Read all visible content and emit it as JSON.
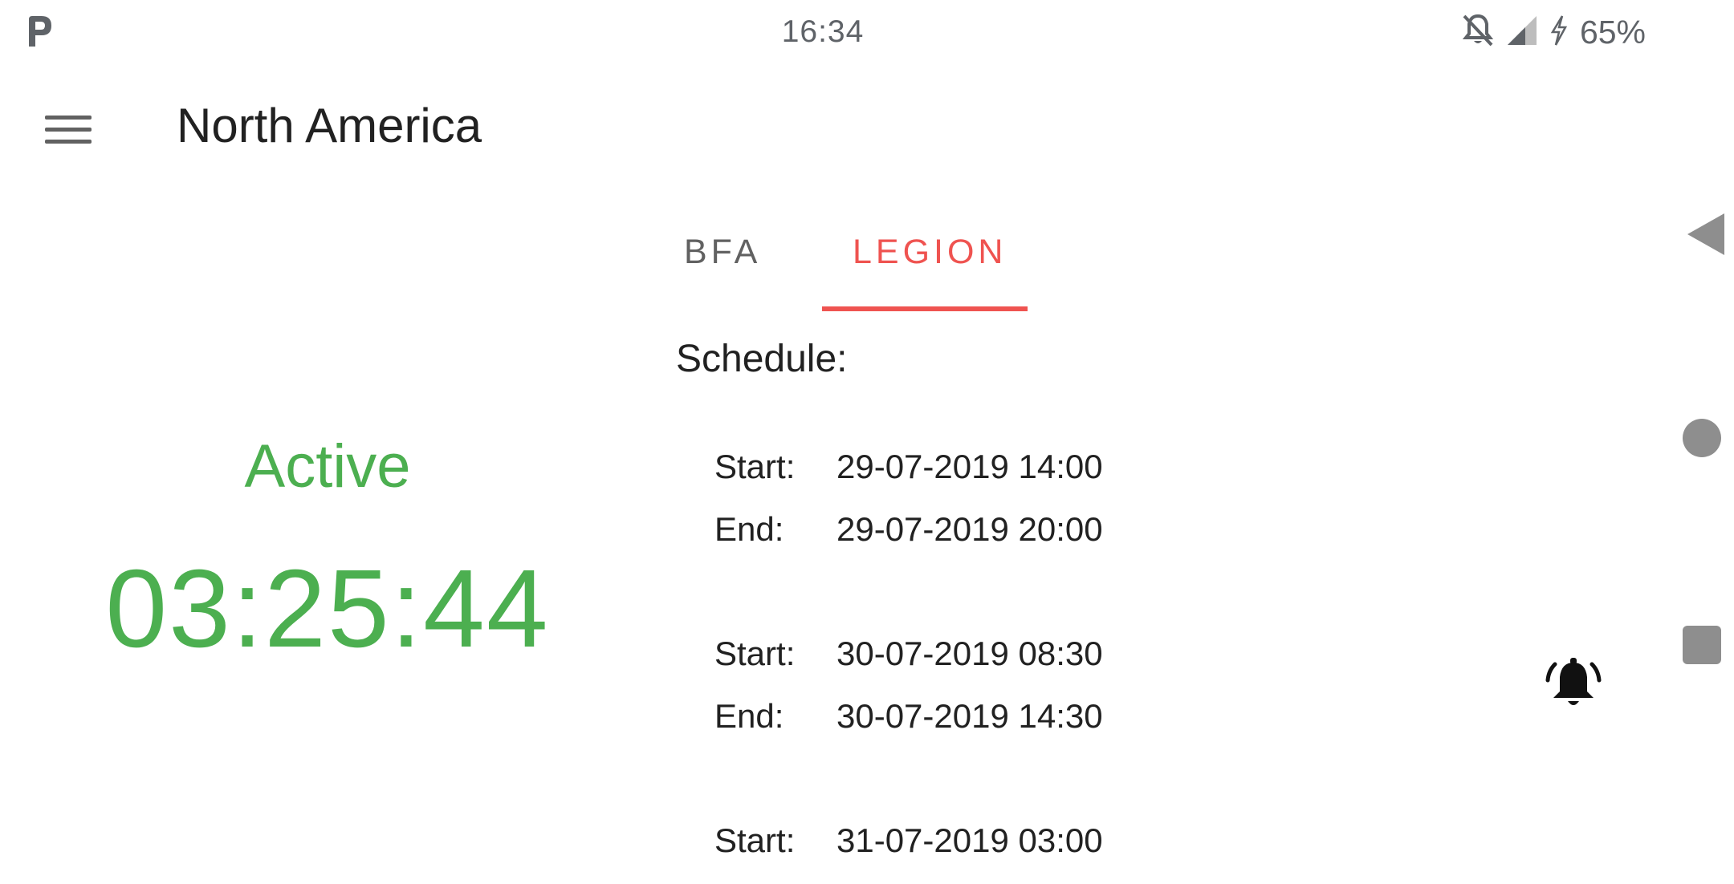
{
  "status_bar": {
    "time": "16:34",
    "battery_percent": "65%",
    "icons": [
      "parking-p-icon",
      "notifications-off-icon",
      "signal-icon",
      "charging-bolt-icon"
    ]
  },
  "app_bar": {
    "title": "North America",
    "menu_icon": "hamburger-menu-icon"
  },
  "tabs": [
    {
      "label": "BFA",
      "selected": false
    },
    {
      "label": "LEGION",
      "selected": true
    }
  ],
  "status": {
    "label": "Active",
    "countdown": "03:25:44"
  },
  "schedule": {
    "title": "Schedule:",
    "start_label": "Start:",
    "end_label": "End:",
    "entries": [
      {
        "start": "29-07-2019 14:00",
        "end": "29-07-2019 20:00"
      },
      {
        "start": "30-07-2019 08:30",
        "end": "30-07-2019 14:30"
      },
      {
        "start": "31-07-2019 03:00"
      }
    ]
  },
  "colors": {
    "accent": "#ef5350",
    "active": "#4caf50",
    "text": "#212121",
    "muted": "#616161"
  },
  "actions": {
    "alarm_icon": "alarm-bell-icon"
  }
}
